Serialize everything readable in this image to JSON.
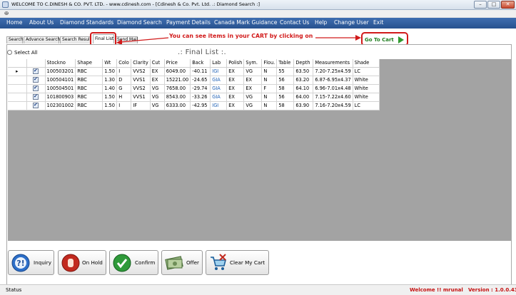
{
  "window": {
    "title": "WELCOME TO C.DINESH & CO. PVT. LTD. - www.cdinesh.com - [Cdinesh & Co. Pvt. Ltd.  .: Diamond Search :]",
    "min": "–",
    "max": "□",
    "close": "✕"
  },
  "menu": [
    "Home",
    "About Us",
    "Diamond Standards",
    "Diamond Search",
    "Payment Details",
    "Canada Mark Guidance",
    "Contact Us",
    "Help",
    "Change User",
    "Exit"
  ],
  "tabs": [
    "Search",
    "Advance Search",
    "Search Result",
    "Final List",
    "Send Mail"
  ],
  "active_tab": "Final List",
  "annotation": "You can see items in your CART by clicking on",
  "cart_button": "Go To Cart",
  "select_all": "Select All",
  "list_title": ".: Final List :.",
  "columns": [
    "Stockno",
    "Shape",
    "Wt",
    "Colo",
    "Clarity",
    "Cut",
    "Price",
    "Back",
    "Lab",
    "Polish",
    "Sym.",
    "Flou.",
    "Table",
    "Depth",
    "Measurements",
    "Shade"
  ],
  "rows": [
    [
      "100503201",
      "RBC",
      "1.50",
      "I",
      "VVS2",
      "EX",
      "6049.00",
      "-40.11",
      "IGI",
      "EX",
      "VG",
      "N",
      "55",
      "63.50",
      "7.20-7.25x4.59",
      "LC"
    ],
    [
      "100504101",
      "RBC",
      "1.30",
      "D",
      "VVS1",
      "EX",
      "15221.00",
      "-24.65",
      "GIA",
      "EX",
      "EX",
      "N",
      "56",
      "63.20",
      "6.87-6.95x4.37",
      "White"
    ],
    [
      "100504501",
      "RBC",
      "1.40",
      "G",
      "VVS2",
      "VG",
      "7658.00",
      "-29.74",
      "GIA",
      "EX",
      "EX",
      "F",
      "58",
      "64.10",
      "6.96-7.01x4.48",
      "White"
    ],
    [
      "101800903",
      "RBC",
      "1.50",
      "H",
      "VVS1",
      "VG",
      "8543.00",
      "-33.26",
      "GIA",
      "EX",
      "VG",
      "N",
      "56",
      "64.00",
      "7.15-7.22x4.60",
      "White"
    ],
    [
      "102301002",
      "RBC",
      "1.50",
      "I",
      "IF",
      "VG",
      "6333.00",
      "-42.95",
      "IGI",
      "EX",
      "VG",
      "N",
      "58",
      "63.90",
      "7.16-7.20x4.59",
      "LC"
    ]
  ],
  "actions": [
    "Inquiry",
    "On Hold",
    "Confirm",
    "Offer",
    "Clear My Cart"
  ],
  "status": {
    "left": "Status",
    "welcome": "Welcome !!",
    "user": "mrunal",
    "version": "Version : 1.0.0.43"
  },
  "colors": {
    "menubar": "#3160a0",
    "annotation": "#d11a1a",
    "cart_text": "#1e7d1e",
    "status_text": "#c41010"
  }
}
